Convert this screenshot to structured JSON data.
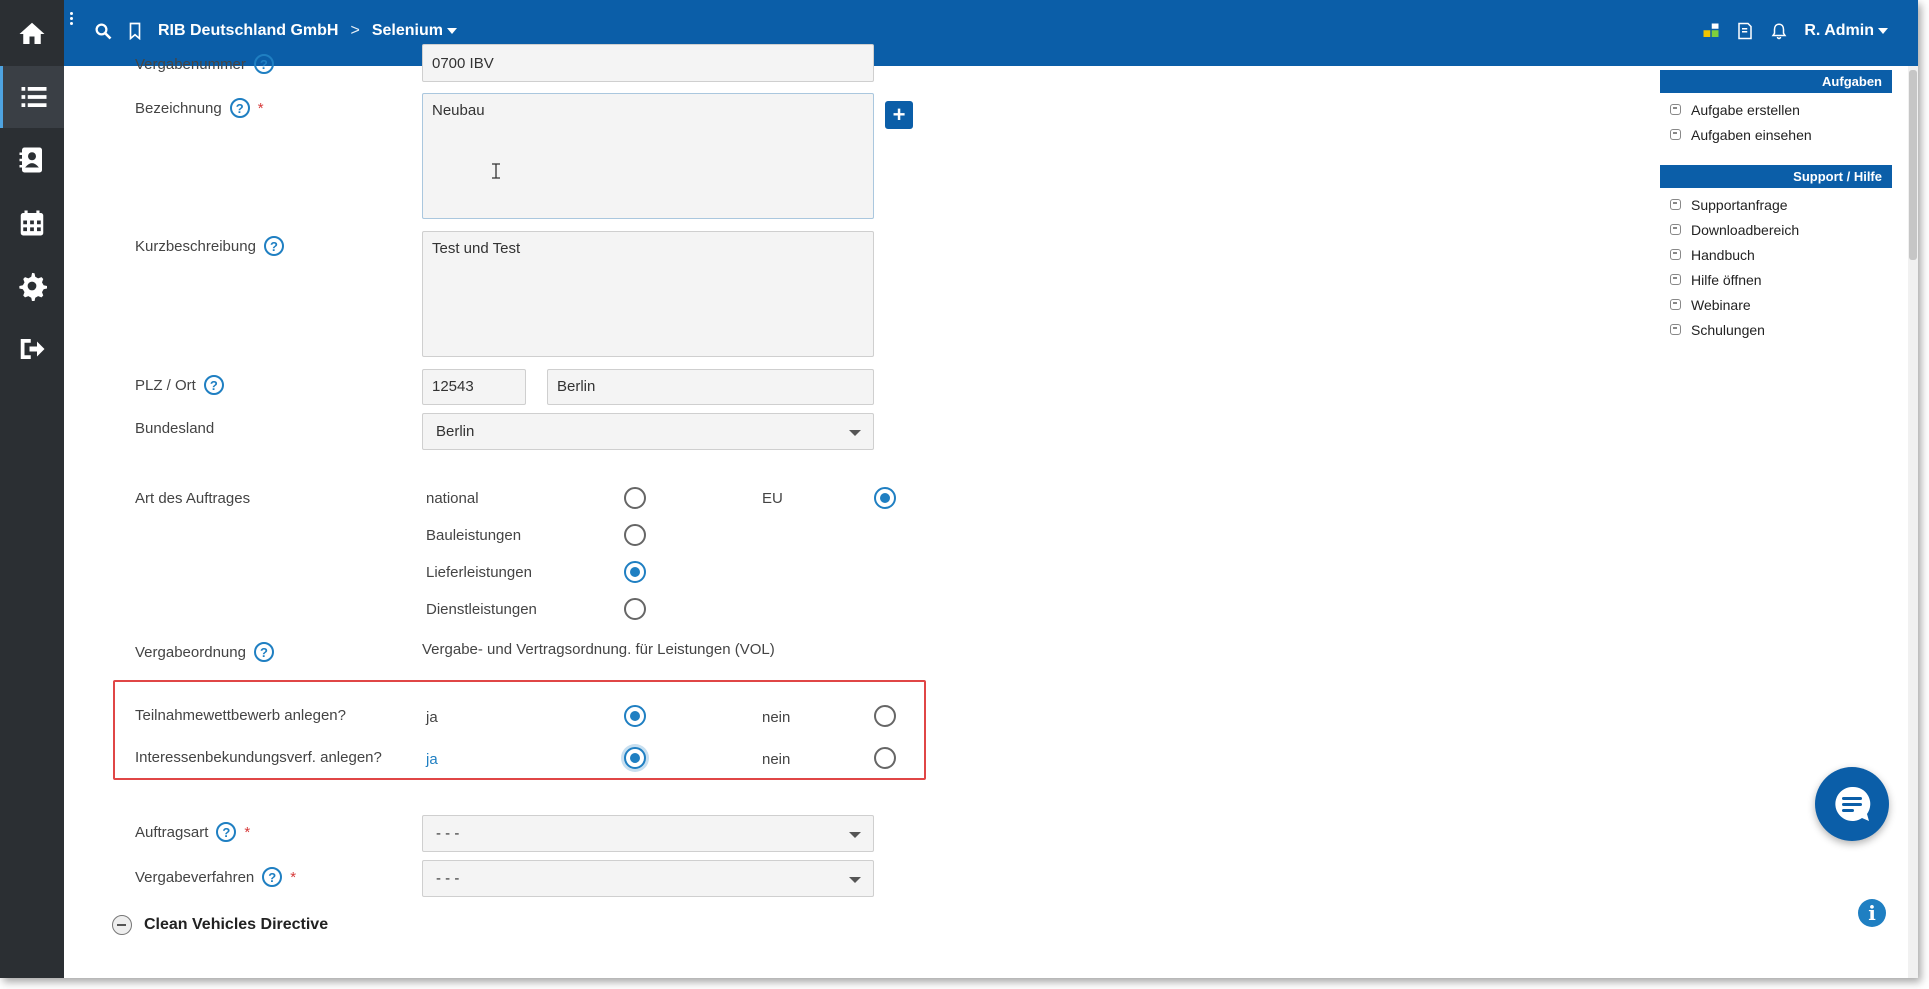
{
  "topbar": {
    "company": "RIB Deutschland GmbH",
    "separator": ">",
    "project": "Selenium",
    "user": "R. Admin",
    "icons": [
      "search-icon",
      "bookmark-icon",
      "apps-icon",
      "note-icon",
      "bell-icon"
    ]
  },
  "sidebar": {
    "items": [
      "home-icon",
      "list-icon",
      "contacts-icon",
      "calendar-icon",
      "gear-icon",
      "logout-icon"
    ]
  },
  "form": {
    "vergabenummer": {
      "label": "Vergabenummer",
      "value": "0700 IBV"
    },
    "bezeichnung": {
      "label": "Bezeichnung",
      "value": "Neubau",
      "required": "*"
    },
    "kurzbeschreibung": {
      "label": "Kurzbeschreibung",
      "value": "Test und Test"
    },
    "plz_ort": {
      "label": "PLZ / Ort",
      "plz": "12543",
      "ort": "Berlin"
    },
    "bundesland": {
      "label": "Bundesland",
      "value": "Berlin"
    },
    "art": {
      "label": "Art des Auftrages",
      "national": "national",
      "eu": "EU",
      "bauleistungen": "Bauleistungen",
      "lieferleistungen": "Lieferleistungen",
      "dienstleistungen": "Dienstleistungen"
    },
    "vergabeordnung": {
      "label": "Vergabeordnung",
      "value": "Vergabe- und Vertragsordnung. für Leistungen (VOL)"
    },
    "teilnahme": {
      "label": "Teilnahmewettbewerb anlegen?",
      "ja": "ja",
      "nein": "nein"
    },
    "interessen": {
      "label": "Interessenbekundungsverf. anlegen?",
      "ja": "ja",
      "nein": "nein"
    },
    "auftragsart": {
      "label": "Auftragsart",
      "value": "- - -",
      "required": "*"
    },
    "vergabeverfahren": {
      "label": "Vergabeverfahren",
      "value": "- - -",
      "required": "*"
    },
    "section_cvd": "Clean Vehicles Directive",
    "help_glyph": "?",
    "plus_glyph": "+"
  },
  "panel": {
    "aufgaben": {
      "title": "Aufgaben",
      "items": [
        "Aufgabe erstellen",
        "Aufgaben einsehen"
      ]
    },
    "support": {
      "title": "Support / Hilfe",
      "items": [
        "Supportanfrage",
        "Downloadbereich",
        "Handbuch",
        "Hilfe öffnen",
        "Webinare",
        "Schulungen"
      ]
    }
  },
  "info_glyph": "i",
  "colors": {
    "brand": "#0b5ea8",
    "accent": "#1f7fc2",
    "highlight": "#e04646",
    "sidebar": "#2b2f33"
  }
}
